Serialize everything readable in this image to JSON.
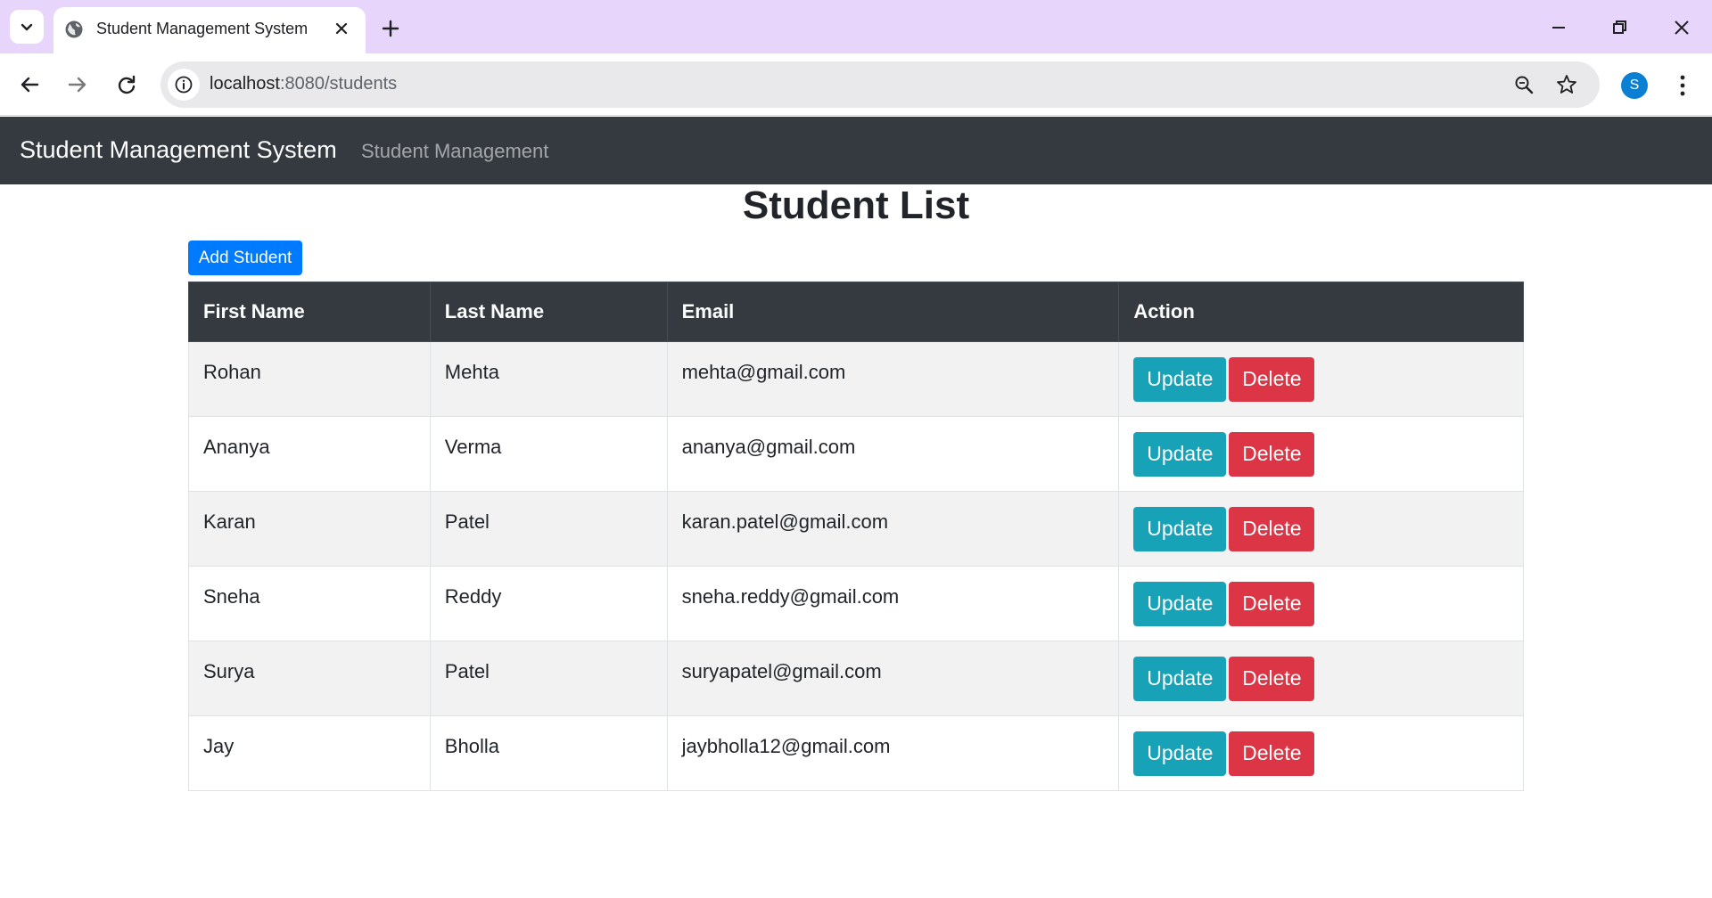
{
  "browser": {
    "tab_title": "Student Management System",
    "url_host": "localhost",
    "url_rest": ":8080/students",
    "profile_initial": "S"
  },
  "app": {
    "brand": "Student Management System",
    "nav_link": "Student Management"
  },
  "page": {
    "title": "Student List",
    "add_button": "Add Student"
  },
  "table": {
    "headers": [
      "First Name",
      "Last Name",
      "Email",
      "Action"
    ],
    "update_label": "Update",
    "delete_label": "Delete",
    "rows": [
      {
        "first_name": "Rohan",
        "last_name": "Mehta",
        "email": "mehta@gmail.com"
      },
      {
        "first_name": "Ananya",
        "last_name": "Verma",
        "email": "ananya@gmail.com"
      },
      {
        "first_name": "Karan",
        "last_name": "Patel",
        "email": "karan.patel@gmail.com"
      },
      {
        "first_name": "Sneha",
        "last_name": "Reddy",
        "email": "sneha.reddy@gmail.com"
      },
      {
        "first_name": "Surya",
        "last_name": "Patel",
        "email": "suryapatel@gmail.com"
      },
      {
        "first_name": "Jay",
        "last_name": "Bholla",
        "email": "jaybholla12@gmail.com"
      }
    ]
  },
  "colors": {
    "tabstrip": "#e8d5fb",
    "navbar": "#343a40",
    "primary": "#007bff",
    "info": "#17a2b8",
    "danger": "#dc3545"
  }
}
